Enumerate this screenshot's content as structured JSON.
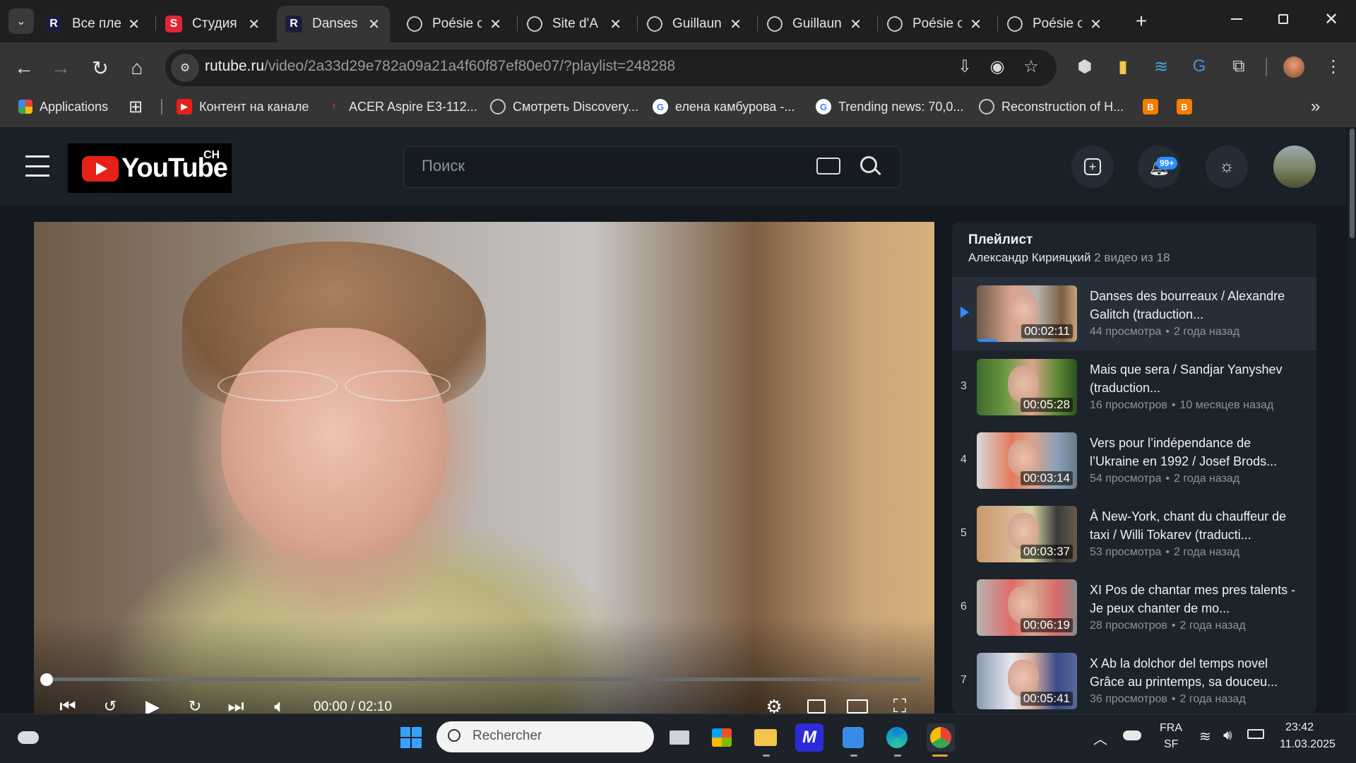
{
  "browser": {
    "tabs": [
      {
        "title": "Все пле",
        "favicon": "R",
        "color": "#1c1c3c"
      },
      {
        "title": "Студия",
        "favicon": "S",
        "color": "#e0243a"
      },
      {
        "title": "Danses",
        "favicon": "R",
        "color": "#1c1c3c",
        "active": true
      },
      {
        "title": "Poésie c",
        "favicon": "globe-icon"
      },
      {
        "title": "Site d'A",
        "favicon": "globe-icon"
      },
      {
        "title": "Guillaun",
        "favicon": "globe-icon"
      },
      {
        "title": "Guillaun",
        "favicon": "globe-icon"
      },
      {
        "title": "Poésie c",
        "favicon": "globe-icon"
      },
      {
        "title": "Poésie c",
        "favicon": "globe-icon"
      }
    ],
    "new_tab": "+",
    "address": {
      "host": "rutube.ru",
      "path": "/video/2a33d29e782a09a21a4f60f87ef80e07/?playlist=248288"
    },
    "bookmarks": [
      {
        "label": "Applications"
      },
      {
        "label": "Контент на канале"
      },
      {
        "label": "ACER Aspire E3-112..."
      },
      {
        "label": "Смотреть Discovery..."
      },
      {
        "label": "елена камбурова -..."
      },
      {
        "label": "Trending news: 70,0..."
      },
      {
        "label": "Reconstruction of H..."
      }
    ],
    "overflow": "»"
  },
  "site": {
    "logo_text": "YouTube",
    "logo_badge": "CH",
    "search_placeholder": "Поиск",
    "notif_count": "99+"
  },
  "player": {
    "time": "00:00 / 02:10",
    "progress": 0.0
  },
  "playlist": {
    "title": "Плейлист",
    "author": "Александр Кирияцкий",
    "count": "2 видео из 18",
    "items": [
      {
        "num": "",
        "title": "Danses des bourreaux / Alexandre Galitch (traduction...",
        "views": "44 просмотра",
        "age": "2 года назад",
        "duration": "00:02:11",
        "active": true,
        "watched": 0.2
      },
      {
        "num": "3",
        "title": "Mais que sera / Sandjar Yanyshev (traduction...",
        "views": "16 просмотров",
        "age": "10 месяцев назад",
        "duration": "00:05:28"
      },
      {
        "num": "4",
        "title": "Vers pour l’indépendance de l’Ukraine en 1992 / Josef Brods...",
        "views": "54 просмотра",
        "age": "2 года назад",
        "duration": "00:03:14"
      },
      {
        "num": "5",
        "title": "À New-York, chant du chauffeur de taxi / Willi Tokarev (traducti...",
        "views": "53 просмотра",
        "age": "2 года назад",
        "duration": "00:03:37"
      },
      {
        "num": "6",
        "title": "XI Pos de chantar mes pres talents - Je peux chanter de mo...",
        "views": "28 просмотров",
        "age": "2 года назад",
        "duration": "00:06:19"
      },
      {
        "num": "7",
        "title": "X Ab la dolchor del temps novel Grâce au printemps, sa douceu...",
        "views": "36 просмотров",
        "age": "2 года назад",
        "duration": "00:05:41"
      }
    ],
    "separator": "•"
  },
  "taskbar": {
    "search_placeholder": "Rechercher",
    "lang": "FRA",
    "layout": "SF",
    "time": "23:42",
    "date": "11.03.2025"
  }
}
